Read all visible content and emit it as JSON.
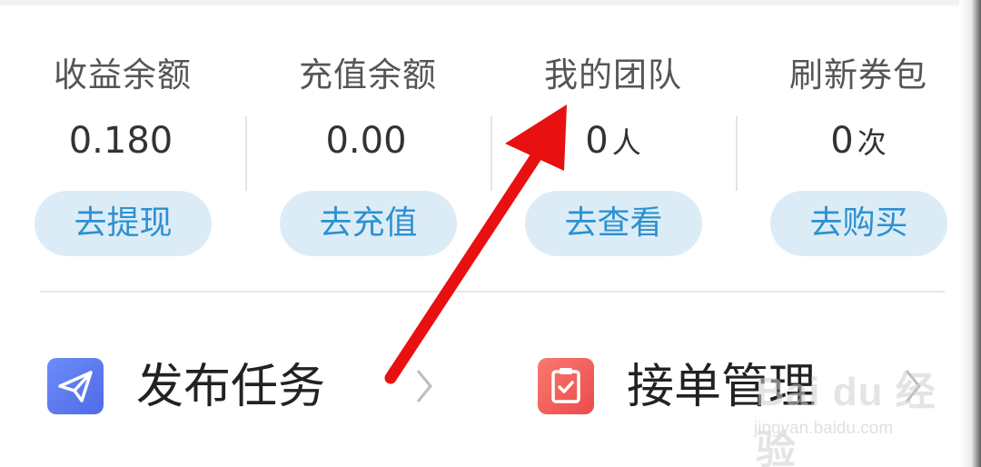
{
  "stats": [
    {
      "label": "收益余额",
      "value": "0.180",
      "unit": "",
      "action": "去提现"
    },
    {
      "label": "充值余额",
      "value": "0.00",
      "unit": "",
      "action": "去充值"
    },
    {
      "label": "我的团队",
      "value": "0",
      "unit": "人",
      "action": "去查看"
    },
    {
      "label": "刷新券包",
      "value": "0",
      "unit": "次",
      "action": "去购买"
    }
  ],
  "menu": {
    "publish_task": "发布任务",
    "order_management": "接单管理"
  },
  "watermark": {
    "brand": "Bai du 经验",
    "url": "jingyan.baidu.com"
  },
  "colors": {
    "action_bg": "#dcecf7",
    "action_text": "#2c91d0",
    "publish_icon": "#5b7cf0",
    "order_icon": "#f05a5a",
    "arrow": "#e81010"
  }
}
